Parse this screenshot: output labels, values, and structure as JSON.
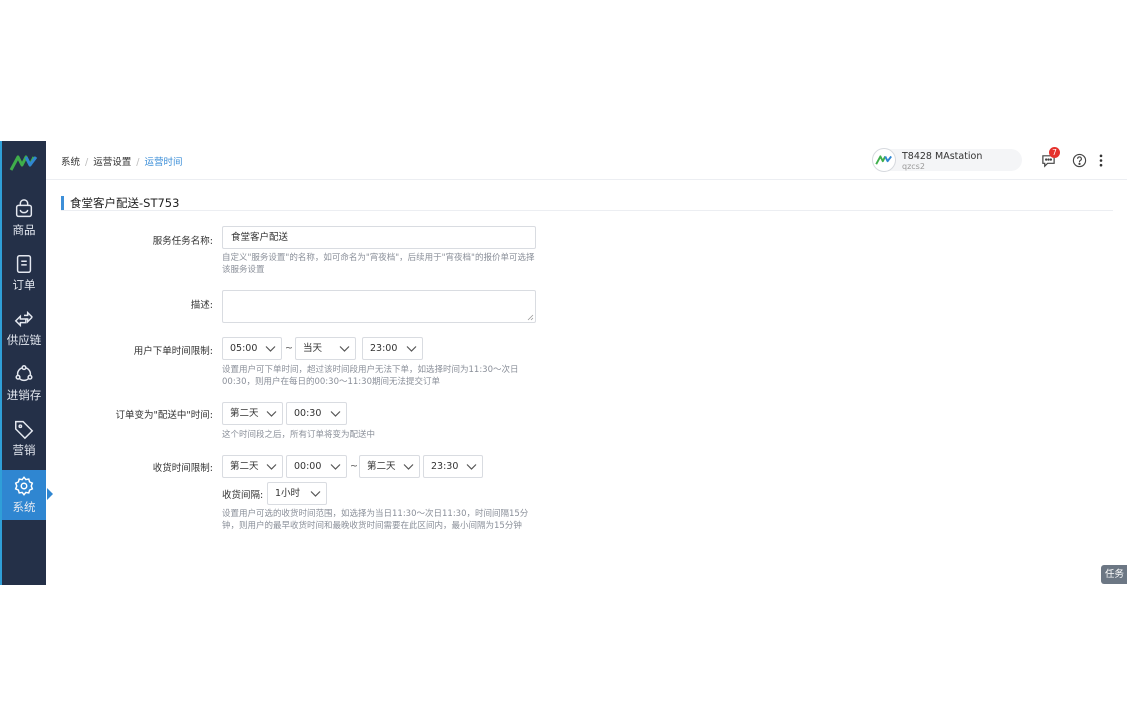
{
  "sidebar": {
    "items": [
      {
        "label": "商品",
        "icon": "shopping-bag-icon"
      },
      {
        "label": "订单",
        "icon": "order-doc-icon"
      },
      {
        "label": "供应链",
        "icon": "exchange-arrows-icon"
      },
      {
        "label": "进销存",
        "icon": "inventory-cycle-icon"
      },
      {
        "label": "营销",
        "icon": "price-tag-icon"
      },
      {
        "label": "系统",
        "icon": "gear-icon",
        "active": true
      }
    ]
  },
  "header": {
    "breadcrumb": [
      "系统",
      "运营设置",
      "运营时间"
    ],
    "account": {
      "name": "T8428 MAstation",
      "sub": "qzcs2"
    },
    "notification_count": "7"
  },
  "section": {
    "title": "食堂客户配送-ST753"
  },
  "form": {
    "service_name": {
      "label": "服务任务名称:",
      "value": "食堂客户配送",
      "help": "自定义\"服务设置\"的名称，如可命名为\"宵夜档\"，后续用于\"宵夜档\"的报价单可选择该服务设置"
    },
    "description": {
      "label": "描述:"
    },
    "order_time": {
      "label": "用户下单时间限制:",
      "start": "05:00",
      "day": "当天",
      "end": "23:00",
      "tilde": "~",
      "help": "设置用户可下单时间，超过该时间段用户无法下单，如选择时间为11:30～次日00:30，则用户在每日的00:30～11:30期间无法提交订单"
    },
    "delivery_status": {
      "label": "订单变为\"配送中\"时间:",
      "day": "第二天",
      "time": "00:30",
      "help": "这个时间段之后，所有订单将变为配送中"
    },
    "receive_time": {
      "label": "收货时间限制:",
      "start_day": "第二天",
      "start_time": "00:00",
      "tilde": "~",
      "end_day": "第二天",
      "end_time": "23:30",
      "interval_label": "收货间隔:",
      "interval": "1小时",
      "help": "设置用户可选的收货时间范围，如选择为当日11:30～次日11:30，时间间隔15分钟，则用户的最早收货时间和最晚收货时间需要在此区间内，最小间隔为15分钟"
    }
  },
  "task_button": "任务",
  "colors": {
    "sidebar_bg": "#243048",
    "accent": "#3d8fd8",
    "badge": "#e5322d"
  }
}
